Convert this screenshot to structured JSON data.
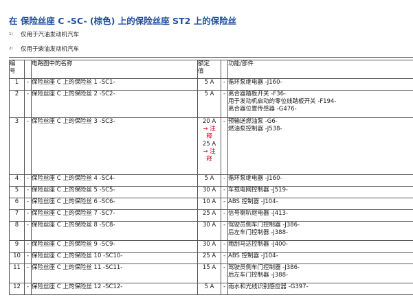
{
  "title": "在 保险丝座 C -SC- (棕色) 上的保险丝座 ST2 上的保险丝",
  "notes": [
    {
      "mark": "1)",
      "text": "仅用于汽油发动机汽车"
    },
    {
      "mark": "2)",
      "text": "仅用于柴油发动机汽车"
    }
  ],
  "header": {
    "num": [
      "编",
      "号"
    ],
    "name": "电路图中的名称",
    "value": [
      "额定",
      "值"
    ],
    "function": "功能/部件"
  },
  "dash": "-",
  "rows": [
    {
      "num": "1",
      "name": "保险丝座 C 上的保险丝 1 -SC1-",
      "values": [
        "5 A"
      ],
      "functions": [
        "循环泵继电器 -J160-"
      ]
    },
    {
      "num": "2",
      "name": "保险丝座 C 上的保险丝 2 -SC2-",
      "values": [
        "5 A"
      ],
      "functions": [
        "离合器踏板开关 -F36-",
        "用于发动机启动的零位线踏板开关 -F194-",
        "离合器位置传感器 -G476-"
      ]
    },
    {
      "num": "3",
      "name": "保险丝座 C 上的保险丝 3 -SC3-",
      "values": [
        "20 A",
        "→ 注",
        "释",
        "25 A",
        "→ 注",
        "释"
      ],
      "functions": [
        "预输送燃油泵 -G6-",
        "燃油泵控制器 -J538-"
      ]
    },
    {
      "num": "4",
      "name": "保险丝座 C 上的保险丝 4 -SC4-",
      "values": [
        "5 A"
      ],
      "functions": [
        "循环泵继电器 -J160-"
      ]
    },
    {
      "num": "5",
      "name": "保险丝座 C 上的保险丝 5 -SC5-",
      "values": [
        "30 A"
      ],
      "functions": [
        "车载电网控制器 -J519-"
      ]
    },
    {
      "num": "6",
      "name": "保险丝座 C 上的保险丝 6 -SC6-",
      "values": [
        "10 A"
      ],
      "functions": [
        "ABS 控制器 -J104-"
      ]
    },
    {
      "num": "7",
      "name": "保险丝座 C 上的保险丝 7 -SC7-",
      "values": [
        "25 A"
      ],
      "functions": [
        "信号喇叭继电器 -J413-"
      ]
    },
    {
      "num": "8",
      "name": "保险丝座 C 上的保险丝 8 -SC8-",
      "values": [
        "30 A"
      ],
      "functions": [
        "驾驶员侧车门控制器 -J386-",
        "后左车门控制器 -J388-"
      ]
    },
    {
      "num": "9",
      "name": "保险丝座 C 上的保险丝 9 -SC9-",
      "values": [
        "30 A"
      ],
      "functions": [
        "雨刮马达控制器 -J400-"
      ]
    },
    {
      "num": "10",
      "name": "保险丝座 C 上的保险丝 10 -SC10-",
      "values": [
        "25 A"
      ],
      "functions": [
        "ABS 控制器 -J104-"
      ]
    },
    {
      "num": "11",
      "name": "保险丝座 C 上的保险丝 11 -SC11-",
      "values": [
        "15 A"
      ],
      "functions": [
        "驾驶员侧车门控制器 -J386-",
        "后左车门控制器 -J388-"
      ]
    },
    {
      "num": "12",
      "name": "保险丝座 C 上的保险丝 12 -SC12-",
      "values": [
        "5 A"
      ],
      "functions": [
        "雨水和光线识别感应器 -G397-"
      ]
    }
  ]
}
